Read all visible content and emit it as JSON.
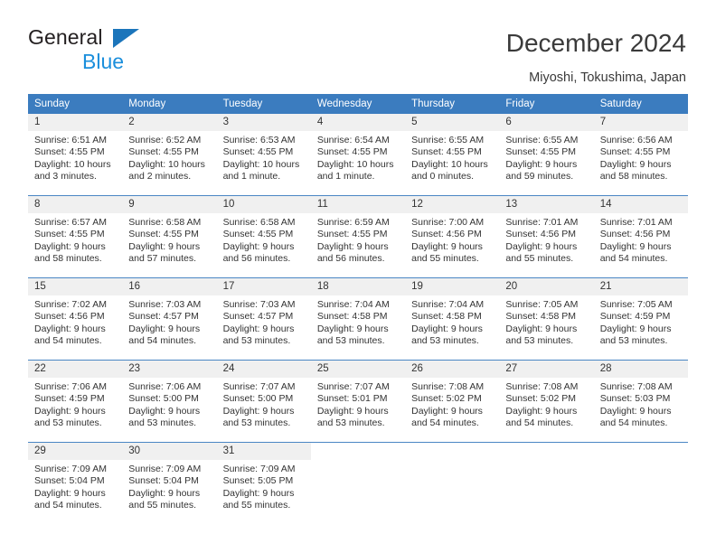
{
  "brand": {
    "name_line1": "General",
    "name_line2": "Blue",
    "accent_color": "#1b8fdc",
    "triangle_color": "#1b75bb"
  },
  "header": {
    "title": "December 2024",
    "subtitle": "Miyoshi, Tokushima, Japan"
  },
  "calendar": {
    "header_background": "#3b7cbf",
    "daynum_background": "#f0f0f0",
    "row_divider_color": "#4a86c4",
    "weekday_headers": [
      "Sunday",
      "Monday",
      "Tuesday",
      "Wednesday",
      "Thursday",
      "Friday",
      "Saturday"
    ],
    "weeks": [
      [
        {
          "day": "1",
          "sunrise": "Sunrise: 6:51 AM",
          "sunset": "Sunset: 4:55 PM",
          "daylight": "Daylight: 10 hours and 3 minutes."
        },
        {
          "day": "2",
          "sunrise": "Sunrise: 6:52 AM",
          "sunset": "Sunset: 4:55 PM",
          "daylight": "Daylight: 10 hours and 2 minutes."
        },
        {
          "day": "3",
          "sunrise": "Sunrise: 6:53 AM",
          "sunset": "Sunset: 4:55 PM",
          "daylight": "Daylight: 10 hours and 1 minute."
        },
        {
          "day": "4",
          "sunrise": "Sunrise: 6:54 AM",
          "sunset": "Sunset: 4:55 PM",
          "daylight": "Daylight: 10 hours and 1 minute."
        },
        {
          "day": "5",
          "sunrise": "Sunrise: 6:55 AM",
          "sunset": "Sunset: 4:55 PM",
          "daylight": "Daylight: 10 hours and 0 minutes."
        },
        {
          "day": "6",
          "sunrise": "Sunrise: 6:55 AM",
          "sunset": "Sunset: 4:55 PM",
          "daylight": "Daylight: 9 hours and 59 minutes."
        },
        {
          "day": "7",
          "sunrise": "Sunrise: 6:56 AM",
          "sunset": "Sunset: 4:55 PM",
          "daylight": "Daylight: 9 hours and 58 minutes."
        }
      ],
      [
        {
          "day": "8",
          "sunrise": "Sunrise: 6:57 AM",
          "sunset": "Sunset: 4:55 PM",
          "daylight": "Daylight: 9 hours and 58 minutes."
        },
        {
          "day": "9",
          "sunrise": "Sunrise: 6:58 AM",
          "sunset": "Sunset: 4:55 PM",
          "daylight": "Daylight: 9 hours and 57 minutes."
        },
        {
          "day": "10",
          "sunrise": "Sunrise: 6:58 AM",
          "sunset": "Sunset: 4:55 PM",
          "daylight": "Daylight: 9 hours and 56 minutes."
        },
        {
          "day": "11",
          "sunrise": "Sunrise: 6:59 AM",
          "sunset": "Sunset: 4:55 PM",
          "daylight": "Daylight: 9 hours and 56 minutes."
        },
        {
          "day": "12",
          "sunrise": "Sunrise: 7:00 AM",
          "sunset": "Sunset: 4:56 PM",
          "daylight": "Daylight: 9 hours and 55 minutes."
        },
        {
          "day": "13",
          "sunrise": "Sunrise: 7:01 AM",
          "sunset": "Sunset: 4:56 PM",
          "daylight": "Daylight: 9 hours and 55 minutes."
        },
        {
          "day": "14",
          "sunrise": "Sunrise: 7:01 AM",
          "sunset": "Sunset: 4:56 PM",
          "daylight": "Daylight: 9 hours and 54 minutes."
        }
      ],
      [
        {
          "day": "15",
          "sunrise": "Sunrise: 7:02 AM",
          "sunset": "Sunset: 4:56 PM",
          "daylight": "Daylight: 9 hours and 54 minutes."
        },
        {
          "day": "16",
          "sunrise": "Sunrise: 7:03 AM",
          "sunset": "Sunset: 4:57 PM",
          "daylight": "Daylight: 9 hours and 54 minutes."
        },
        {
          "day": "17",
          "sunrise": "Sunrise: 7:03 AM",
          "sunset": "Sunset: 4:57 PM",
          "daylight": "Daylight: 9 hours and 53 minutes."
        },
        {
          "day": "18",
          "sunrise": "Sunrise: 7:04 AM",
          "sunset": "Sunset: 4:58 PM",
          "daylight": "Daylight: 9 hours and 53 minutes."
        },
        {
          "day": "19",
          "sunrise": "Sunrise: 7:04 AM",
          "sunset": "Sunset: 4:58 PM",
          "daylight": "Daylight: 9 hours and 53 minutes."
        },
        {
          "day": "20",
          "sunrise": "Sunrise: 7:05 AM",
          "sunset": "Sunset: 4:58 PM",
          "daylight": "Daylight: 9 hours and 53 minutes."
        },
        {
          "day": "21",
          "sunrise": "Sunrise: 7:05 AM",
          "sunset": "Sunset: 4:59 PM",
          "daylight": "Daylight: 9 hours and 53 minutes."
        }
      ],
      [
        {
          "day": "22",
          "sunrise": "Sunrise: 7:06 AM",
          "sunset": "Sunset: 4:59 PM",
          "daylight": "Daylight: 9 hours and 53 minutes."
        },
        {
          "day": "23",
          "sunrise": "Sunrise: 7:06 AM",
          "sunset": "Sunset: 5:00 PM",
          "daylight": "Daylight: 9 hours and 53 minutes."
        },
        {
          "day": "24",
          "sunrise": "Sunrise: 7:07 AM",
          "sunset": "Sunset: 5:00 PM",
          "daylight": "Daylight: 9 hours and 53 minutes."
        },
        {
          "day": "25",
          "sunrise": "Sunrise: 7:07 AM",
          "sunset": "Sunset: 5:01 PM",
          "daylight": "Daylight: 9 hours and 53 minutes."
        },
        {
          "day": "26",
          "sunrise": "Sunrise: 7:08 AM",
          "sunset": "Sunset: 5:02 PM",
          "daylight": "Daylight: 9 hours and 54 minutes."
        },
        {
          "day": "27",
          "sunrise": "Sunrise: 7:08 AM",
          "sunset": "Sunset: 5:02 PM",
          "daylight": "Daylight: 9 hours and 54 minutes."
        },
        {
          "day": "28",
          "sunrise": "Sunrise: 7:08 AM",
          "sunset": "Sunset: 5:03 PM",
          "daylight": "Daylight: 9 hours and 54 minutes."
        }
      ],
      [
        {
          "day": "29",
          "sunrise": "Sunrise: 7:09 AM",
          "sunset": "Sunset: 5:04 PM",
          "daylight": "Daylight: 9 hours and 54 minutes."
        },
        {
          "day": "30",
          "sunrise": "Sunrise: 7:09 AM",
          "sunset": "Sunset: 5:04 PM",
          "daylight": "Daylight: 9 hours and 55 minutes."
        },
        {
          "day": "31",
          "sunrise": "Sunrise: 7:09 AM",
          "sunset": "Sunset: 5:05 PM",
          "daylight": "Daylight: 9 hours and 55 minutes."
        },
        {
          "day": "",
          "sunrise": "",
          "sunset": "",
          "daylight": ""
        },
        {
          "day": "",
          "sunrise": "",
          "sunset": "",
          "daylight": ""
        },
        {
          "day": "",
          "sunrise": "",
          "sunset": "",
          "daylight": ""
        },
        {
          "day": "",
          "sunrise": "",
          "sunset": "",
          "daylight": ""
        }
      ]
    ]
  }
}
